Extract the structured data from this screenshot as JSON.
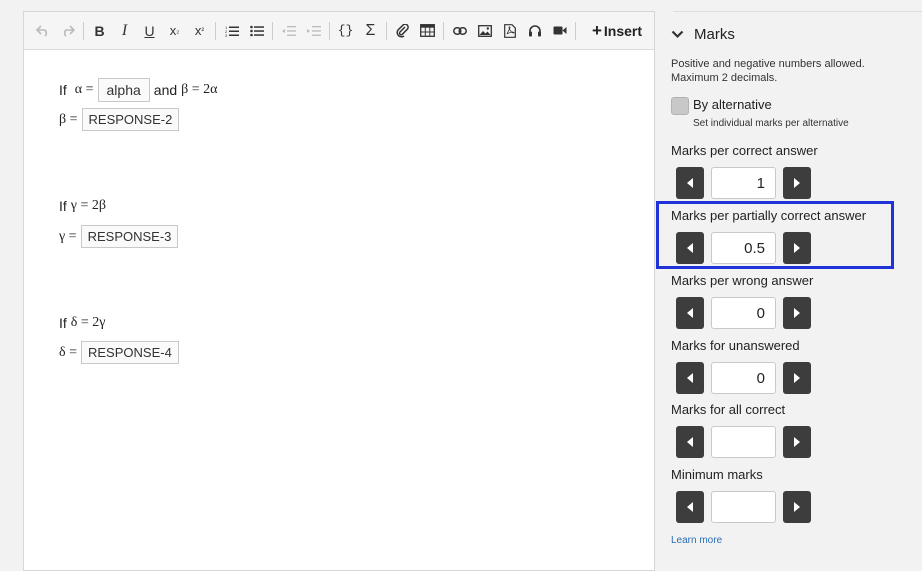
{
  "toolbar": {
    "insert_label": "Insert",
    "icons": [
      "undo-icon",
      "redo-icon",
      "bold-icon",
      "italic-icon",
      "underline-icon",
      "subscript-icon",
      "superscript-icon",
      "ordered-list-icon",
      "bullet-list-icon",
      "outdent-icon",
      "indent-icon",
      "code-icon",
      "sigma-icon",
      "paperclip-icon",
      "table-icon",
      "link-icon",
      "image-icon",
      "pdf-icon",
      "audio-icon",
      "video-icon"
    ]
  },
  "editor": {
    "line1": {
      "if": "If",
      "expr_a": "α =",
      "resp": "alpha",
      "and": "and",
      "expr_b": "β = 2α"
    },
    "line2": {
      "lhs": "β =",
      "resp": "RESPONSE-2"
    },
    "line3": {
      "if": "If",
      "expr": "γ = 2β"
    },
    "line4": {
      "lhs": "γ =",
      "resp": "RESPONSE-3"
    },
    "line5": {
      "if": "If",
      "expr": "δ = 2γ"
    },
    "line6": {
      "lhs": "δ =",
      "resp": "RESPONSE-4"
    }
  },
  "sidebar": {
    "section_title": "Marks",
    "note_line1": "Positive and negative numbers allowed.",
    "note_line2": "Maximum 2 decimals.",
    "by_alternative": "By alternative",
    "by_alternative_sub": "Set individual marks per alternative",
    "fields": [
      {
        "label": "Marks per correct answer",
        "value": "1"
      },
      {
        "label": "Marks per partially correct answer",
        "value": "0.5"
      },
      {
        "label": "Marks per wrong answer",
        "value": "0"
      },
      {
        "label": "Marks for unanswered",
        "value": "0"
      },
      {
        "label": "Marks for all correct",
        "value": ""
      },
      {
        "label": "Minimum marks",
        "value": ""
      }
    ],
    "learn_more": "Learn more",
    "highlight_color": "#1f33d8"
  }
}
